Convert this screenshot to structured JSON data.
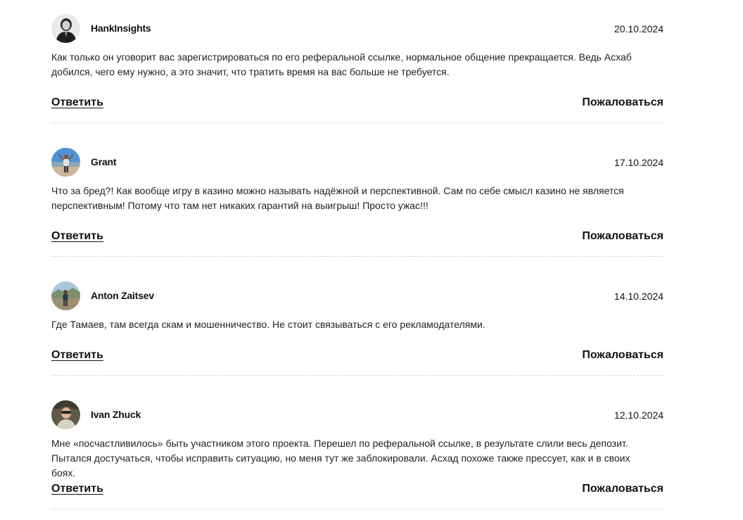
{
  "comments": [
    {
      "author": "HankInsights",
      "date": "20.10.2024",
      "text": "Как только он уговорит вас зарегистрироваться по его реферальной ссылке, нормальное общение прекращается. Ведь Асхаб добился, чего ему нужно, а это значит, что тратить время на вас больше не требуется.",
      "reply_label": "Ответить",
      "report_label": "Пожаловаться",
      "avatar_icon": "user-avatar-photo"
    },
    {
      "author": "Grant",
      "date": "17.10.2024",
      "text": "Что за бред?! Как вообще игру в казино можно называть надёжной и перспективной. Сам по себе смысл казино не является перспективным! Потому что там нет никаких гарантий на выигрыш! Просто ужас!!!",
      "reply_label": "Ответить",
      "report_label": "Пожаловаться",
      "avatar_icon": "user-avatar-photo"
    },
    {
      "author": "Anton Zaitsev",
      "date": "14.10.2024",
      "text": "Где Тамаев, там всегда скам и мошенничество. Не стоит связываться с его рекламодателями.",
      "reply_label": "Ответить",
      "report_label": "Пожаловаться",
      "avatar_icon": "user-avatar-photo"
    },
    {
      "author": "Ivan Zhuck",
      "date": "12.10.2024",
      "text": "Мне «посчастливилось» быть участником этого проекта. Перешел по реферальной ссылке, в результате слили весь депозит. Пытался достучаться, чтобы исправить ситуацию, но меня тут же заблокировали. Асхад похоже также прессует, как и в своих боях.",
      "reply_label": "Ответить",
      "report_label": "Пожаловаться",
      "avatar_icon": "user-avatar-photo"
    }
  ]
}
